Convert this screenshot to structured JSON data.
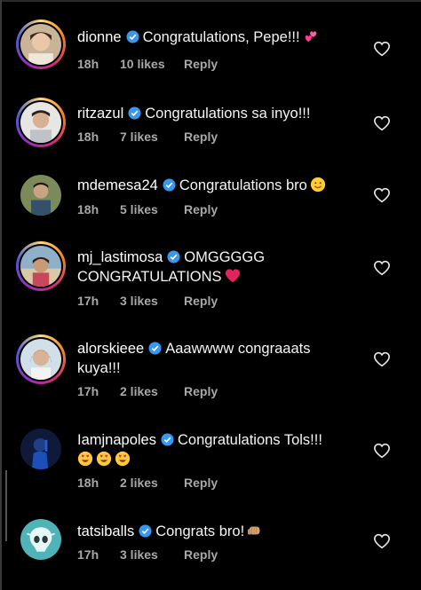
{
  "comments": [
    {
      "username": "dionne",
      "text_line1": "Congratulations, Pepe!!!",
      "text_line2": "",
      "emoji": "hearts-emoji",
      "time": "18h",
      "likes": "10 likes",
      "reply": "Reply",
      "story_ring": true
    },
    {
      "username": "ritzazul",
      "text_line1": "Congratulations sa inyo!!!",
      "text_line2": "",
      "emoji": "",
      "time": "18h",
      "likes": "7 likes",
      "reply": "Reply",
      "story_ring": true
    },
    {
      "username": "mdemesa24",
      "text_line1": "Congratulations bro",
      "text_line2": "",
      "emoji": "smile-emoji",
      "time": "18h",
      "likes": "5 likes",
      "reply": "Reply",
      "story_ring": false
    },
    {
      "username": "mj_lastimosa",
      "text_line1": "OMGGGGG",
      "text_line2": "CONGRATULATIONS",
      "emoji": "red-heart-emoji",
      "time": "17h",
      "likes": "3 likes",
      "reply": "Reply",
      "story_ring": true
    },
    {
      "username": "alorskieee",
      "text_line1": "Aaawwww congraaats",
      "text_line2": "kuya!!!",
      "emoji": "",
      "time": "17h",
      "likes": "2 likes",
      "reply": "Reply",
      "story_ring": true
    },
    {
      "username": "Iamjnapoles",
      "text_line1": "Congratulations Tols!!!",
      "text_line2": "",
      "emoji": "heart-eyes-emoji",
      "time": "18h",
      "likes": "2 likes",
      "reply": "Reply",
      "story_ring": false
    },
    {
      "username": "tatsiballs",
      "text_line1": "Congrats bro!",
      "text_line2": "",
      "emoji": "fist-bump-emoji",
      "time": "17h",
      "likes": "3 likes",
      "reply": "Reply",
      "story_ring": false
    }
  ],
  "colors": {
    "background": "#000000",
    "text": "#f5f5f5",
    "meta": "#a8a8a8",
    "verified": "#3897f0",
    "heart_red": "#e0245e"
  },
  "icons": {
    "verified": "verified-badge-icon",
    "like": "heart-outline-icon"
  }
}
